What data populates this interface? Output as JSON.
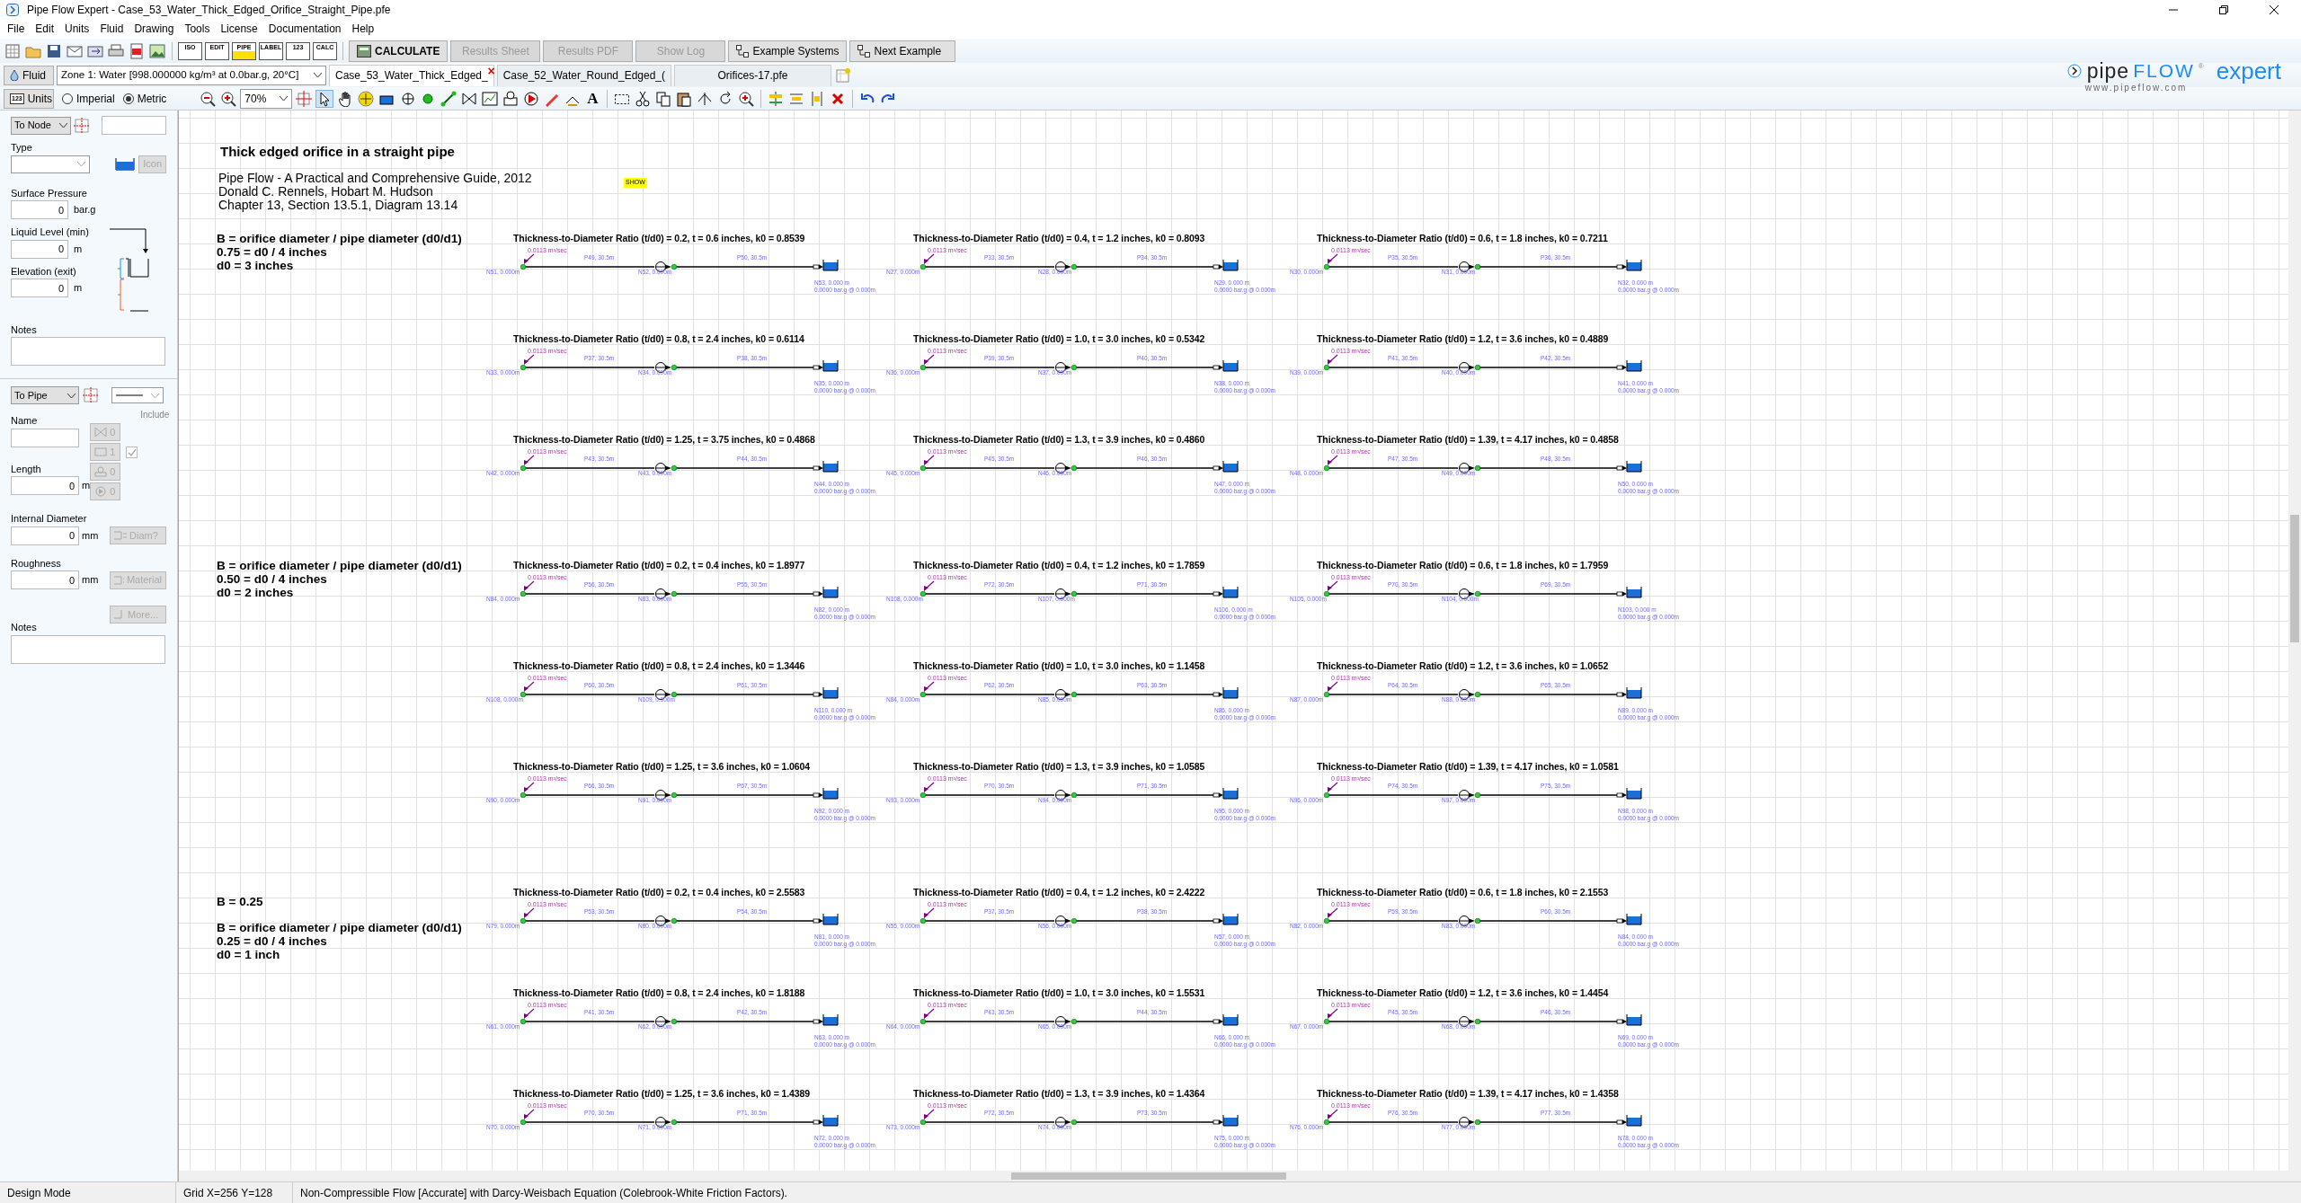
{
  "window": {
    "title": "Pipe Flow Expert - Case_53_Water_Thick_Edged_Orifice_Straight_Pipe.pfe"
  },
  "menu": [
    "File",
    "Edit",
    "Units",
    "Fluid",
    "Drawing",
    "Tools",
    "License",
    "Documentation",
    "Help"
  ],
  "toolbar": {
    "label_icons": [
      "ISO",
      "EDIT",
      "PIPE",
      "LABEL",
      "123",
      "CALC"
    ],
    "buttons": [
      {
        "label": "CALCULATE",
        "disabled": false,
        "kind": "calc"
      },
      {
        "label": "Results Sheet",
        "disabled": true,
        "kind": "plain"
      },
      {
        "label": "Results PDF",
        "disabled": true,
        "kind": "plain"
      },
      {
        "label": "Show Log",
        "disabled": true,
        "kind": "plain"
      },
      {
        "label": "Example Systems",
        "disabled": false,
        "kind": "examples"
      },
      {
        "label": "Next Example",
        "disabled": false,
        "kind": "next"
      }
    ]
  },
  "fluid_bar": {
    "fluid_button": "Fluid",
    "zone": "Zone 1: Water [998.000000 kg/m³ at 0.0bar.g, 20°C]",
    "tabs": [
      {
        "label": "Case_53_Water_Thick_Edged_",
        "selected": true,
        "close": "×"
      },
      {
        "label": "Case_52_Water_Round_Edged_(",
        "selected": false
      },
      {
        "label": "Orifices-17.pfe",
        "selected": false
      }
    ]
  },
  "units_bar": {
    "units_button": "Units",
    "units_icon": "123",
    "radios": [
      {
        "label": "Imperial",
        "selected": false
      },
      {
        "label": "Metric",
        "selected": true
      }
    ],
    "zoom": "70%",
    "text_tool": "A"
  },
  "logo": {
    "pipe": "pipe",
    "flow": "FLOW",
    "mark": "®",
    "product": "expert",
    "url": "www.pipeflow.com"
  },
  "node_panel": {
    "target": "To Node",
    "type_label": "Type",
    "icon_button": "Icon",
    "fields": [
      {
        "label": "Surface Pressure",
        "value": "0",
        "unit": "bar.g"
      },
      {
        "label": "Liquid Level (min)",
        "value": "0",
        "unit": "m"
      },
      {
        "label": "Elevation (exit)",
        "value": "0",
        "unit": "m"
      }
    ],
    "notes_label": "Notes"
  },
  "pipe_panel": {
    "target": "To Pipe",
    "name_label": "Name",
    "include_label": "Include",
    "counts": [
      {
        "value": "0",
        "kind": "valve"
      },
      {
        "value": "1",
        "kind": "component"
      },
      {
        "value": "0",
        "kind": "control"
      },
      {
        "value": "0",
        "kind": "pump"
      }
    ],
    "include_checked": true,
    "fields": [
      {
        "label": "Length",
        "value": "0",
        "unit": "m"
      },
      {
        "label": "Internal Diameter",
        "value": "0",
        "unit": "mm",
        "button": "Diam?"
      },
      {
        "label": "Roughness",
        "value": "0",
        "unit": "mm",
        "button": "Material"
      }
    ],
    "more_button": "More...",
    "notes_label": "Notes"
  },
  "canvas": {
    "title": "Thick edged orifice in a straight pipe",
    "reference": [
      "Pipe Flow - A Practical and Comprehensive Guide, 2012",
      "Donald C. Rennels, Hobart M. Hudson",
      "Chapter 13, Section 13.5.1, Diagram 13.14"
    ],
    "tag": "SHOW",
    "sections": [
      {
        "lines": [
          "B = orifice diameter / pipe diameter (d0/d1)",
          "0.75 = d0 / 4 inches",
          "d0 = 3 inches"
        ],
        "diagrams": [
          {
            "title": "Thickness-to-Diameter Ratio (t/d0) = 0.2, t = 0.6 inches, k0 = 0.8539",
            "flow": "0.0113 m³/sec",
            "nodes": [
              "N51, 0.000m",
              "N52, 0.000m",
              "N53, 0.000 m"
            ],
            "pipes": [
              "P49, 30.5m",
              "P50, 30.5m"
            ],
            "pressure": "0.0000 bar.g @ 0.000m"
          },
          {
            "title": "Thickness-to-Diameter Ratio (t/d0) = 0.4, t = 1.2 inches, k0 = 0.8093",
            "flow": "0.0113 m³/sec",
            "nodes": [
              "N27, 0.000m",
              "N28, 0.000m",
              "N29, 0.000 m"
            ],
            "pipes": [
              "P33, 30.5m",
              "P34, 30.5m"
            ],
            "pressure": "0.0000 bar.g @ 0.000m"
          },
          {
            "title": "Thickness-to-Diameter Ratio (t/d0) = 0.6, t = 1.8 inches, k0 = 0.7211",
            "flow": "0.0113 m³/sec",
            "nodes": [
              "N30, 0.000m",
              "N31, 0.000m",
              "N32, 0.000 m"
            ],
            "pipes": [
              "P35, 30.5m",
              "P36, 30.5m"
            ],
            "pressure": "0.0000 bar.g @ 0.000m"
          },
          {
            "title": "Thickness-to-Diameter Ratio (t/d0) = 0.8, t = 2.4 inches, k0 = 0.6114",
            "flow": "0.0113 m³/sec",
            "nodes": [
              "N33, 0.000m",
              "N34, 0.000m",
              "N35, 0.000 m"
            ],
            "pipes": [
              "P37, 30.5m",
              "P38, 30.5m"
            ],
            "pressure": "0.0000 bar.g @ 0.000m"
          },
          {
            "title": "Thickness-to-Diameter Ratio (t/d0) = 1.0, t = 3.0 inches, k0 = 0.5342",
            "flow": "0.0113 m³/sec",
            "nodes": [
              "N36, 0.000m",
              "N37, 0.000m",
              "N38, 0.000 m"
            ],
            "pipes": [
              "P39, 30.5m",
              "P40, 30.5m"
            ],
            "pressure": "0.0000 bar.g @ 0.000m"
          },
          {
            "title": "Thickness-to-Diameter Ratio (t/d0) = 1.2, t = 3.6 inches, k0 = 0.4889",
            "flow": "0.0113 m³/sec",
            "nodes": [
              "N39, 0.000m",
              "N40, 0.000m",
              "N41, 0.000 m"
            ],
            "pipes": [
              "P41, 30.5m",
              "P42, 30.5m"
            ],
            "pressure": "0.0000 bar.g @ 0.000m"
          },
          {
            "title": "Thickness-to-Diameter Ratio (t/d0) = 1.25, t = 3.75 inches, k0 = 0.4868",
            "flow": "0.0113 m³/sec",
            "nodes": [
              "N42, 0.000m",
              "N43, 0.000m",
              "N44, 0.000 m"
            ],
            "pipes": [
              "P43, 30.5m",
              "P44, 30.5m"
            ],
            "pressure": "0.0000 bar.g @ 0.000m"
          },
          {
            "title": "Thickness-to-Diameter Ratio (t/d0) = 1.3, t = 3.9 inches, k0 = 0.4860",
            "flow": "0.0113 m³/sec",
            "nodes": [
              "N45, 0.000m",
              "N46, 0.000m",
              "N47, 0.000 m"
            ],
            "pipes": [
              "P45, 30.5m",
              "P46, 30.5m"
            ],
            "pressure": "0.0000 bar.g @ 0.000m"
          },
          {
            "title": "Thickness-to-Diameter Ratio (t/d0) = 1.39, t = 4.17 inches, k0 = 0.4858",
            "flow": "0.0113 m³/sec",
            "nodes": [
              "N48, 0.000m",
              "N49, 0.000m",
              "N50, 0.000 m"
            ],
            "pipes": [
              "P47, 30.5m",
              "P48, 30.5m"
            ],
            "pressure": "0.0000 bar.g @ 0.000m"
          }
        ]
      },
      {
        "lines": [
          "B = orifice diameter / pipe diameter (d0/d1)",
          "0.50 = d0 / 4 inches",
          "d0 = 2 inches"
        ],
        "diagrams": [
          {
            "title": "Thickness-to-Diameter Ratio (t/d0) = 0.2, t = 0.4 inches, k0 = 1.8977",
            "flow": "0.0113 m³/sec",
            "nodes": [
              "N84, 0.000m",
              "N83, 0.000m",
              "N82, 0.000 m"
            ],
            "pipes": [
              "P56, 30.5m",
              "P55, 30.5m"
            ],
            "pressure": "0.0000 bar.g @ 0.000m"
          },
          {
            "title": "Thickness-to-Diameter Ratio (t/d0) = 0.4, t = 1.2 inches, k0 = 1.7859",
            "flow": "0.0113 m³/sec",
            "nodes": [
              "N108, 0.000m",
              "N107, 0.000m",
              "N106, 0.000 m"
            ],
            "pipes": [
              "P72, 30.5m",
              "P71, 30.5m"
            ],
            "pressure": "0.0000 bar.g @ 0.000m"
          },
          {
            "title": "Thickness-to-Diameter Ratio (t/d0) = 0.6, t = 1.8 inches, k0 = 1.7959",
            "flow": "0.0113 m³/sec",
            "nodes": [
              "N105, 0.000m",
              "N104, 0.000m",
              "N103, 0.000 m"
            ],
            "pipes": [
              "P70, 30.5m",
              "P69, 30.5m"
            ],
            "pressure": "0.0000 bar.g @ 0.000m"
          },
          {
            "title": "Thickness-to-Diameter Ratio (t/d0) = 0.8, t = 2.4 inches, k0 = 1.3446",
            "flow": "0.0113 m³/sec",
            "nodes": [
              "N108, 0.000m",
              "N109, 0.000m",
              "N110, 0.000 m"
            ],
            "pipes": [
              "P60, 30.5m",
              "P61, 30.5m"
            ],
            "pressure": "0.0000 bar.g @ 0.000m"
          },
          {
            "title": "Thickness-to-Diameter Ratio (t/d0) = 1.0, t = 3.0 inches, k0 = 1.1458",
            "flow": "0.0113 m³/sec",
            "nodes": [
              "N84, 0.000m",
              "N85, 0.000m",
              "N86, 0.000 m"
            ],
            "pipes": [
              "P62, 30.5m",
              "P63, 30.5m"
            ],
            "pressure": "0.0000 bar.g @ 0.000m"
          },
          {
            "title": "Thickness-to-Diameter Ratio (t/d0) = 1.2, t = 3.6 inches, k0 = 1.0652",
            "flow": "0.0113 m³/sec",
            "nodes": [
              "N87, 0.000m",
              "N88, 0.000m",
              "N89, 0.000 m"
            ],
            "pipes": [
              "P64, 30.5m",
              "P65, 30.5m"
            ],
            "pressure": "0.0000 bar.g @ 0.000m"
          },
          {
            "title": "Thickness-to-Diameter Ratio (t/d0) = 1.25, t = 3.6 inches, k0 = 1.0604",
            "flow": "0.0113 m³/sec",
            "nodes": [
              "N90, 0.000m",
              "N91, 0.000m",
              "N92, 0.000 m"
            ],
            "pipes": [
              "P66, 30.5m",
              "P67, 30.5m"
            ],
            "pressure": "0.0000 bar.g @ 0.000m"
          },
          {
            "title": "Thickness-to-Diameter Ratio (t/d0) = 1.3, t = 3.9 inches, k0 = 1.0585",
            "flow": "0.0113 m³/sec",
            "nodes": [
              "N93, 0.000m",
              "N94, 0.000m",
              "N95, 0.000 m"
            ],
            "pipes": [
              "P70, 30.5m",
              "P71, 30.5m"
            ],
            "pressure": "0.0000 bar.g @ 0.000m"
          },
          {
            "title": "Thickness-to-Diameter Ratio (t/d0) = 1.39, t = 4.17 inches, k0 = 1.0581",
            "flow": "0.0113 m³/sec",
            "nodes": [
              "N96, 0.000m",
              "N97, 0.000m",
              "N98, 0.000 m"
            ],
            "pipes": [
              "P74, 30.5m",
              "P75, 30.5m"
            ],
            "pressure": "0.0000 bar.g @ 0.000m"
          }
        ]
      },
      {
        "heading": "B = 0.25",
        "lines": [
          "B = orifice diameter / pipe diameter (d0/d1)",
          "0.25 = d0 / 4 inches",
          "d0 = 1 inch"
        ],
        "diagrams": [
          {
            "title": "Thickness-to-Diameter Ratio (t/d0) = 0.2, t = 0.4 inches, k0 = 2.5583",
            "flow": "0.0113 m³/sec",
            "nodes": [
              "N79, 0.000m",
              "N80, 0.000m",
              "N81, 0.000 m"
            ],
            "pipes": [
              "P53, 30.5m",
              "P54, 30.5m"
            ],
            "pressure": "0.0000 bar.g @ 0.000m"
          },
          {
            "title": "Thickness-to-Diameter Ratio (t/d0) = 0.4, t = 1.2 inches, k0 = 2.4222",
            "flow": "0.0113 m³/sec",
            "nodes": [
              "N55, 0.000m",
              "N56, 0.000m",
              "N57, 0.000 m"
            ],
            "pipes": [
              "P37, 30.5m",
              "P38, 30.5m"
            ],
            "pressure": "0.0000 bar.g @ 0.000m"
          },
          {
            "title": "Thickness-to-Diameter Ratio (t/d0) = 0.6, t = 1.8 inches, k0 = 2.1553",
            "flow": "0.0113 m³/sec",
            "nodes": [
              "N82, 0.000m",
              "N83, 0.000m",
              "N84, 0.000 m"
            ],
            "pipes": [
              "P59, 30.5m",
              "P60, 30.5m"
            ],
            "pressure": "0.0000 bar.g @ 0.000m"
          },
          {
            "title": "Thickness-to-Diameter Ratio (t/d0) = 0.8, t = 2.4 inches, k0 = 1.8188",
            "flow": "0.0113 m³/sec",
            "nodes": [
              "N61, 0.000m",
              "N62, 0.000m",
              "N63, 0.000 m"
            ],
            "pipes": [
              "P41, 30.5m",
              "P42, 30.5m"
            ],
            "pressure": "0.0000 bar.g @ 0.000m"
          },
          {
            "title": "Thickness-to-Diameter Ratio (t/d0) = 1.0, t = 3.0 inches, k0 = 1.5531",
            "flow": "0.0113 m³/sec",
            "nodes": [
              "N64, 0.000m",
              "N65, 0.000m",
              "N66, 0.000 m"
            ],
            "pipes": [
              "P43, 30.5m",
              "P44, 30.5m"
            ],
            "pressure": "0.0000 bar.g @ 0.000m"
          },
          {
            "title": "Thickness-to-Diameter Ratio (t/d0) = 1.2, t = 3.6 inches, k0 = 1.4454",
            "flow": "0.0113 m³/sec",
            "nodes": [
              "N67, 0.000m",
              "N68, 0.000m",
              "N69, 0.000 m"
            ],
            "pipes": [
              "P45, 30.5m",
              "P46, 30.5m"
            ],
            "pressure": "0.0000 bar.g @ 0.000m"
          },
          {
            "title": "Thickness-to-Diameter Ratio (t/d0) = 1.25, t = 3.6 inches, k0 = 1.4389",
            "flow": "0.0113 m³/sec",
            "nodes": [
              "N70, 0.000m",
              "N71, 0.000m",
              "N72, 0.000 m"
            ],
            "pipes": [
              "P70, 30.5m",
              "P71, 30.5m"
            ],
            "pressure": "0.0000 bar.g @ 0.000m"
          },
          {
            "title": "Thickness-to-Diameter Ratio (t/d0) = 1.3, t = 3.9 inches, k0 = 1.4364",
            "flow": "0.0113 m³/sec",
            "nodes": [
              "N73, 0.000m",
              "N74, 0.000m",
              "N75, 0.000 m"
            ],
            "pipes": [
              "P72, 30.5m",
              "P73, 30.5m"
            ],
            "pressure": "0.0000 bar.g @ 0.000m"
          },
          {
            "title": "Thickness-to-Diameter Ratio (t/d0) = 1.39, t = 4.17 inches, k0 = 1.4358",
            "flow": "0.0113 m³/sec",
            "nodes": [
              "N76, 0.000m",
              "N77, 0.000m",
              "N78, 0.000 m"
            ],
            "pipes": [
              "P76, 30.5m",
              "P77, 30.5m"
            ],
            "pressure": "0.0000 bar.g @ 0.000m"
          }
        ]
      }
    ]
  },
  "status_bar": [
    "Design Mode",
    "Grid  X=256  Y=128",
    "Non-Compressible Flow [Accurate] with Darcy-Weisbach Equation (Colebrook-White Friction Factors)."
  ]
}
